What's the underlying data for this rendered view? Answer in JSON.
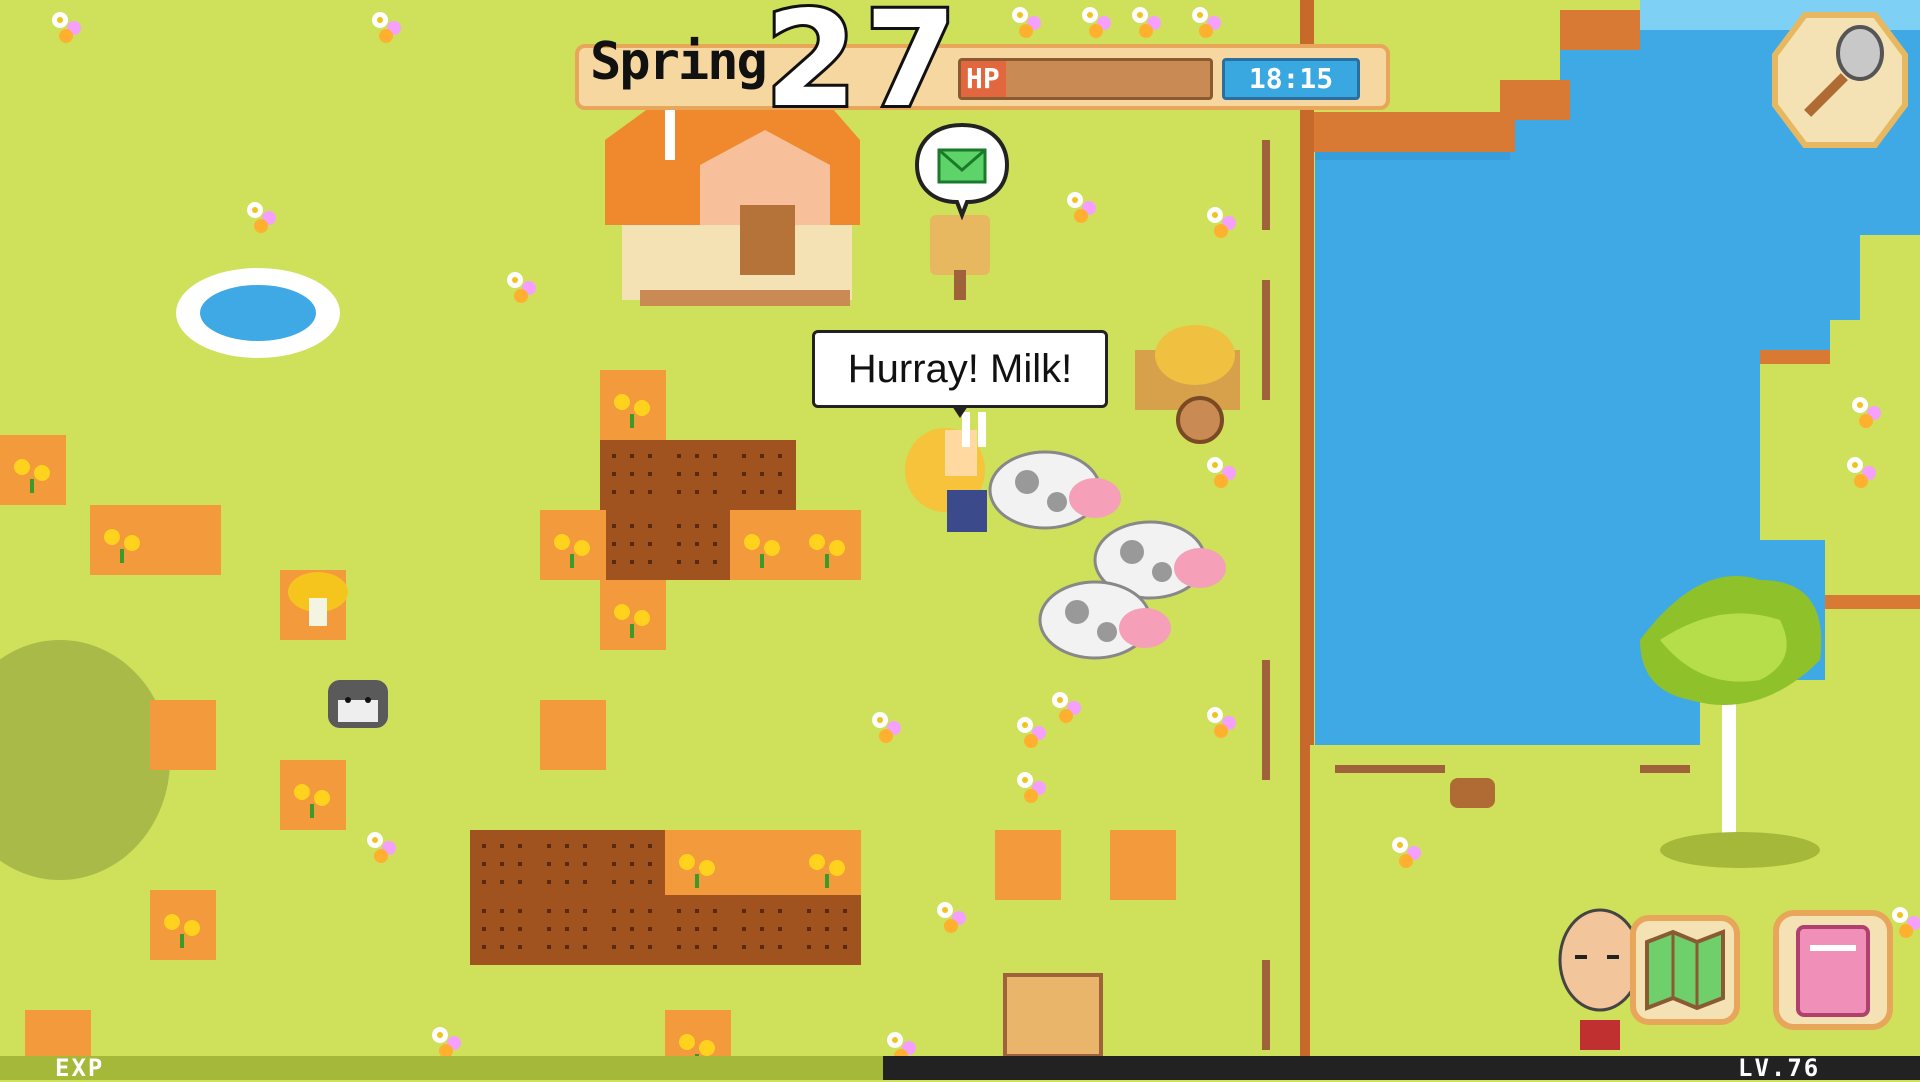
{
  "hud": {
    "season": "Spring",
    "day": "27",
    "hp_label": "HP",
    "hp_fraction": 0.18,
    "time": "18:15"
  },
  "dialog": {
    "text": "Hurray! Milk!"
  },
  "mail": {
    "icon": "envelope-icon"
  },
  "footer": {
    "exp_label": "EXP",
    "exp_fraction": 0.46,
    "level": "LV.76"
  },
  "buttons": {
    "tool": "shovel-icon",
    "map": "map-icon",
    "journal": "book-icon",
    "character": "character-portrait"
  },
  "colors": {
    "grass": "#cfe05a",
    "soil": "#f29a3c",
    "tilled": "#a0521f",
    "water": "#3fa9e6",
    "hud_bg": "#f6d7a0",
    "hp_bar": "#c98a53",
    "clock_bg": "#3aa8e0"
  }
}
